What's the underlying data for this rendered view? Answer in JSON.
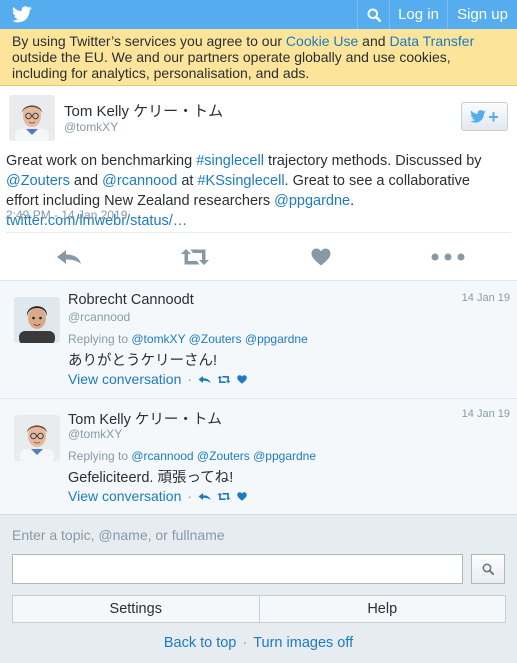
{
  "topbar": {
    "logo_icon": "twitter-bird-icon",
    "search_icon": "search-icon",
    "login_label": "Log in",
    "signup_label": "Sign up",
    "color": "#55acee"
  },
  "cookie_notice": {
    "text_1": "By using Twitter’s services you agree to our ",
    "cookie_link": "Cookie Use",
    "text_2": " and ",
    "transfer_link": "Data Transfer",
    "text_3": " outside the EU. We and our partners operate globally and use cookies, including for analytics, personalisation, and ads."
  },
  "tweet": {
    "name": "Tom Kelly ケリー・トム",
    "handle": "@tomkXY",
    "text_1": "Great work on benchmarking ",
    "hashtag_1": "#singlecell",
    "text_2": " trajectory methods. Discussed by ",
    "mention_1": "@Zouters",
    "text_3": " and ",
    "mention_2": "@rcannood",
    "text_4": " at ",
    "hashtag_2": "#KSsinglecell",
    "text_5": ". Great to see a collaborative effort including New Zealand researchers ",
    "mention_3": "@ppgardne",
    "text_6": ". ",
    "link": "twitter.com/lmwebr/status/…",
    "timestamp": "2:49 PM - 14 Jan 2019",
    "actions": [
      "reply-icon",
      "retweet-icon",
      "like-icon",
      "more-icon"
    ]
  },
  "replies": [
    {
      "name": "Robrecht Cannoodt",
      "handle": "@rcannood",
      "date": "14 Jan 19",
      "replying_label": "Replying to ",
      "replying_to": "@tomkXY @Zouters @ppgardne",
      "text": "ありがとうケリーさん!",
      "view_label": "View conversation",
      "sep": "·"
    },
    {
      "name": "Tom Kelly ケリー・トム",
      "handle": "@tomkXY",
      "date": "14 Jan 19",
      "replying_label": "Replying to ",
      "replying_to": "@rcannood @Zouters @ppgardne",
      "text": "Gefeliciteerd. 頑張ってね!",
      "view_label": "View conversation",
      "sep": "·"
    }
  ],
  "search": {
    "label": "Enter a topic, @name, or fullname",
    "value": "",
    "button_icon": "search-icon"
  },
  "buttons": {
    "settings": "Settings",
    "help": "Help"
  },
  "footer": {
    "back_to_top": "Back to top",
    "sep": "·",
    "images_off": "Turn images off"
  }
}
